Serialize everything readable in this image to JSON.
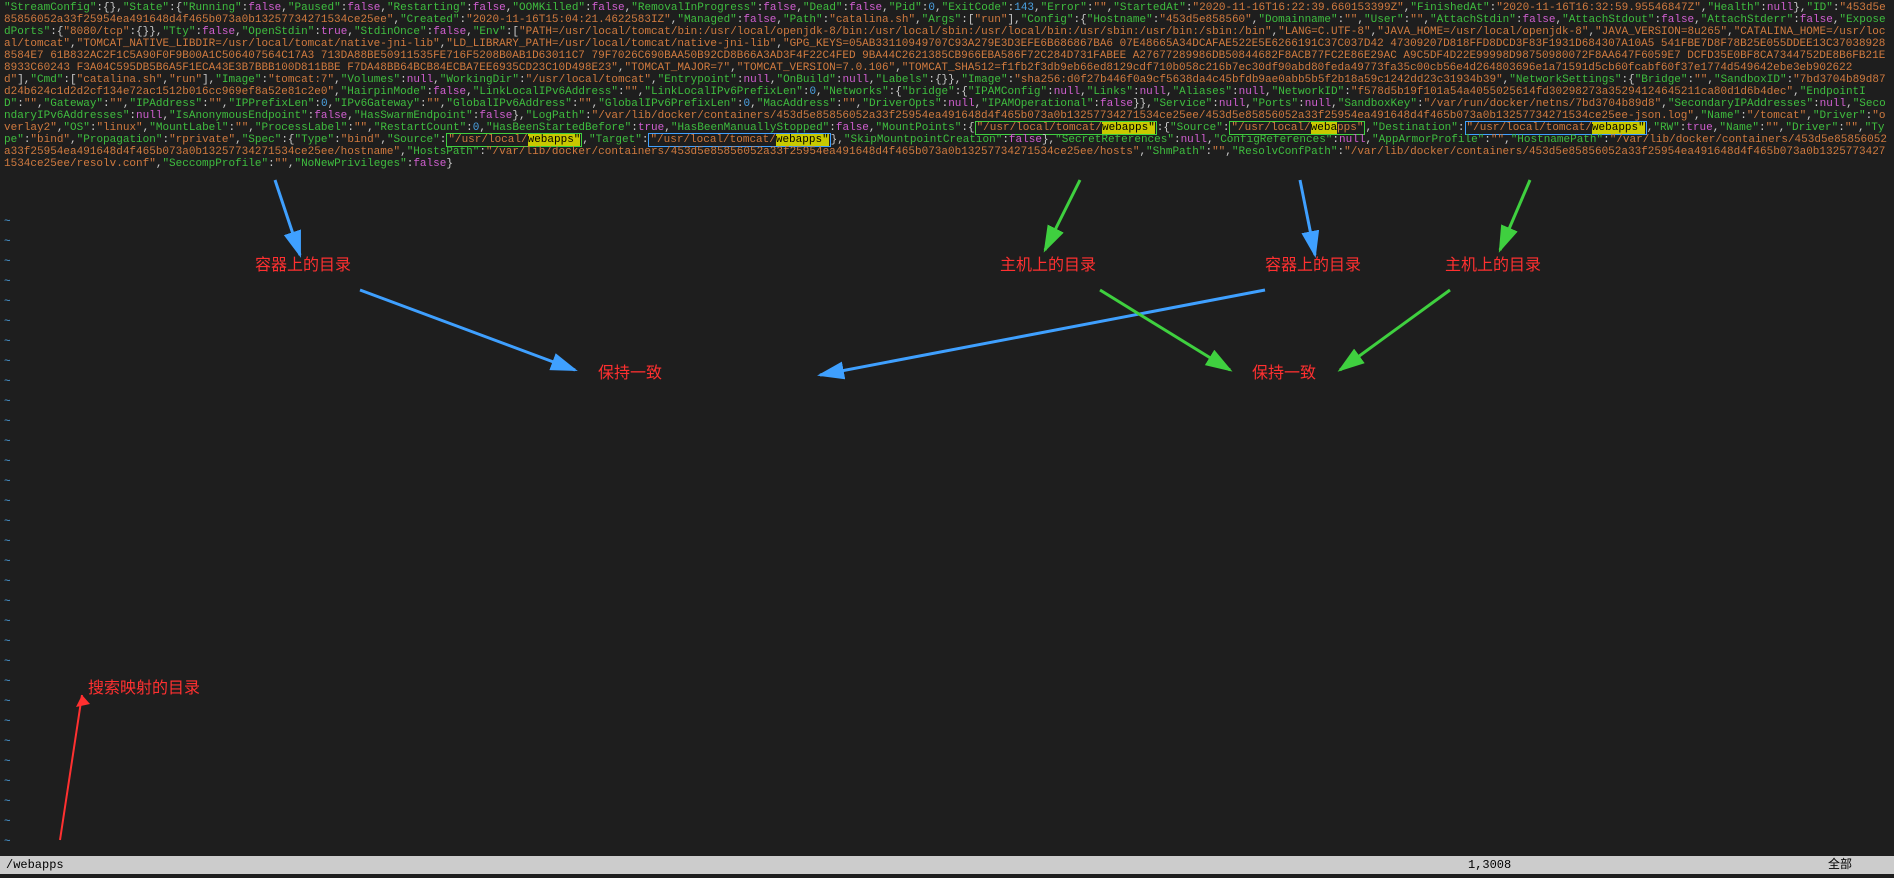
{
  "json_blocks": [
    [
      "k",
      "\"StreamConfig\"",
      "p",
      ":{},",
      "k",
      "\"State\"",
      "p",
      ":{",
      "k",
      "\"Running\"",
      "p",
      ":",
      "b",
      "false",
      "p",
      ",",
      "k",
      "\"Paused\"",
      "p",
      ":",
      "b",
      "false",
      "p",
      ",",
      "k",
      "\"Restarting\"",
      "p",
      ":",
      "b",
      "false",
      "p",
      ",",
      "k",
      "\"OOMKilled\"",
      "p",
      ":",
      "b",
      "false",
      "p",
      ",",
      "k",
      "\"RemovalInProgress\"",
      "p",
      ":",
      "b",
      "false",
      "p",
      ",",
      "k",
      "\"Dead\"",
      "p",
      ":",
      "b",
      "false",
      "p",
      ",",
      "k",
      "\"Pid\"",
      "p",
      ":",
      "n",
      "0",
      "p",
      ",",
      "k",
      "\"ExitCode\"",
      "p",
      ":",
      "n",
      "143",
      "p",
      ",",
      "k",
      "\"Error\"",
      "p",
      ":",
      "s",
      "\"\"",
      "p",
      ",",
      "k",
      "\"StartedAt\"",
      "p",
      ":",
      "s",
      "\"2020-11-16T16:22:39.660153399Z\"",
      "p",
      ",",
      "k",
      "\"FinishedAt\"",
      "p",
      ":",
      "s",
      "\"2020-11-16T16:32:59.95546847Z\"",
      "p",
      ",",
      "k",
      "\"Health\"",
      "p",
      ":",
      "b",
      "null",
      "p",
      "},",
      "k",
      "\"ID\"",
      "p",
      ":",
      "s",
      "\"453d5e85856052a33f25954ea491648d4f465b073a0b13257734271534ce25ee\"",
      "p",
      ",",
      "k",
      "\"Created\"",
      "p",
      ":",
      "s",
      "\"2020-11-16T15:04:21.4622583IZ\"",
      "p",
      ",",
      "k",
      "\"Managed\"",
      "p",
      ":",
      "b",
      "false",
      "p",
      ",",
      "k",
      "\"Path\"",
      "p",
      ":",
      "s",
      "\"catalina.sh\"",
      "p",
      ",",
      "k",
      "\"Args\"",
      "p",
      ":[",
      "s",
      "\"run\"",
      "p",
      "],",
      "k",
      "\"Config\"",
      "p",
      ":{",
      "k",
      "\"Hostname\"",
      "p",
      ":",
      "s",
      "\"453d5e858560\"",
      "p",
      ",",
      "k",
      "\"Domainname\"",
      "p",
      ":",
      "s",
      "\"\"",
      "p",
      ",",
      "k",
      "\"User\"",
      "p",
      ":",
      "s",
      "\"\"",
      "p",
      ",",
      "k",
      "\"AttachStdin\"",
      "p",
      ":",
      "b",
      "false",
      "p",
      ",",
      "k",
      "\"AttachStdout\"",
      "p",
      ":",
      "b",
      "false",
      "p",
      ",",
      "k",
      "\"AttachStderr\"",
      "p",
      ":",
      "b",
      "false",
      "p",
      ",",
      "k",
      "\"ExposedPorts\"",
      "p",
      ":{",
      "s",
      "\"8080/tcp\"",
      "p",
      ":{}},",
      "k",
      "\"Tty\"",
      "p",
      ":",
      "b",
      "false",
      "p",
      ",",
      "k",
      "\"OpenStdin\"",
      "p",
      ":",
      "b",
      "true",
      "p",
      ",",
      "k",
      "\"StdinOnce\"",
      "p",
      ":",
      "b",
      "false",
      "p",
      ",",
      "k",
      "\"Env\"",
      "p",
      ":[",
      "s",
      "\"PATH=/usr/local/tomcat/bin:/usr/local/openjdk-8/bin:/usr/local/sbin:/usr/local/bin:/usr/sbin:/usr/bin:/sbin:/bin\"",
      "p",
      ",",
      "s",
      "\"LANG=C.UTF-8\"",
      "p",
      ",",
      "s",
      "\"JAVA_HOME=/usr/local/openjdk-8\"",
      "p",
      ",",
      "s",
      "\"JAVA_VERSION=8u265\"",
      "p",
      ",",
      "s",
      "\"CATALINA_HOME=/usr/local/tomcat\"",
      "p",
      ",",
      "s",
      "\"TOMCAT_NATIVE_LIBDIR=/usr/local/tomcat/native-jni-lib\"",
      "p",
      ",",
      "s",
      "\"LD_LIBRARY_PATH=/usr/local/tomcat/native-jni-lib\"",
      "p",
      ",",
      "s",
      "\"GPG_KEYS=05AB33110949707C93A279E3D3EFE6B686867BA6 07E48665A34DCAFAE522E5E6266191C37C037D42 47309207D818FFD8DCD3F83F1931D684307A10A5 541FBE7D8F78B25E055DDEE13C370389288584E7 61B832AC2F1C5A90F0F9B00A1C506407564C17A3 713DA88BE50911535FE716F5208B0AB1D63011C7 79F7026C690BAA50B92CD8B66A3AD3F4F22C4FED 9BA44C2621385CB966EBA586F72C284D731FABEE A27677289986DB50844682F8ACB77FC2E86E29AC A9C5DF4D22E99998D98750980072F8AA647F6059E7 DCFD35E0BF8CA7344752DE8B6FB21E8933C60243 F3A04C595DB5B6A5F1ECA43E3B7BBB100D811BBE F7DA48BB64BCB84ECBA7EE6935CD23C10D498E23\"",
      "p",
      ",",
      "s",
      "\"TOMCAT_MAJOR=7\"",
      "p",
      ",",
      "s",
      "\"TOMCAT_VERSION=7.0.106\"",
      "p",
      ",",
      "s",
      "\"TOMCAT_SHA512=f1fb2f3db9eb66ed8129cdf710b058c216b7ec30df90abd80feda49773fa35c00cb56e4d264803696e1a71591d5cb60fcabf60f37e1774d549642ebe3eb902622d\"",
      "p",
      "],",
      "k",
      "\"Cmd\"",
      "p",
      ":[",
      "s",
      "\"catalina.sh\"",
      "p",
      ",",
      "s",
      "\"run\"",
      "p",
      "],",
      "k",
      "\"Image\"",
      "p",
      ":",
      "s",
      "\"tomcat:7\"",
      "p",
      ",",
      "k",
      "\"Volumes\"",
      "p",
      ":",
      "b",
      "null",
      "p",
      ",",
      "k",
      "\"WorkingDir\"",
      "p",
      ":",
      "s",
      "\"/usr/local/tomcat\"",
      "p",
      ",",
      "k",
      "\"Entrypoint\"",
      "p",
      ":",
      "b",
      "null",
      "p",
      ",",
      "k",
      "\"OnBuild\"",
      "p",
      ":",
      "b",
      "null",
      "p",
      ",",
      "k",
      "\"Labels\"",
      "p",
      ":{}},",
      "k",
      "\"Image\"",
      "p",
      ":",
      "s",
      "\"sha256:d0f27b446f0a9cf5638da4c45bfdb9ae0abb5b5f2b18a59c1242dd23c31934b39\"",
      "p",
      ",",
      "k",
      "\"NetworkSettings\"",
      "p",
      ":{",
      "k",
      "\"Bridge\"",
      "p",
      ":",
      "s",
      "\"\"",
      "p",
      ",",
      "k",
      "\"SandboxID\"",
      "p",
      ":",
      "s",
      "\"7bd3704b89d87d24b624c1d2d2cf134e72ac1512b016cc969ef8a52e81c2e0\"",
      "p",
      ",",
      "k",
      "\"HairpinMode\"",
      "p",
      ":",
      "b",
      "false",
      "p",
      ",",
      "k",
      "\"LinkLocalIPv6Address\"",
      "p",
      ":",
      "s",
      "\"\"",
      "p",
      ",",
      "k",
      "\"LinkLocalIPv6PrefixLen\"",
      "p",
      ":",
      "n",
      "0",
      "p",
      ",",
      "k",
      "\"Networks\"",
      "p",
      ":{",
      "k",
      "\"bridge\"",
      "p",
      ":{",
      "k",
      "\"IPAMConfig\"",
      "p",
      ":",
      "b",
      "null",
      "p",
      ",",
      "k",
      "\"Links\"",
      "p",
      ":",
      "b",
      "null",
      "p",
      ",",
      "k",
      "\"Aliases\"",
      "p",
      ":",
      "b",
      "null",
      "p",
      ",",
      "k",
      "\"NetworkID\"",
      "p",
      ":",
      "s",
      "\"f578d5b19f101a54a4055025614fd30298273a35294124645211ca80d1d6b4dec\"",
      "p",
      ",",
      "k",
      "\"EndpointID\"",
      "p",
      ":",
      "s",
      "\"\"",
      "p",
      ",",
      "k",
      "\"Gateway\"",
      "p",
      ":",
      "s",
      "\"\"",
      "p",
      ",",
      "k",
      "\"IPAddress\"",
      "p",
      ":",
      "s",
      "\"\"",
      "p",
      ",",
      "k",
      "\"IPPrefixLen\"",
      "p",
      ":",
      "n",
      "0",
      "p",
      ",",
      "k",
      "\"IPv6Gateway\"",
      "p",
      ":",
      "s",
      "\"\"",
      "p",
      ",",
      "k",
      "\"GlobalIPv6Address\"",
      "p",
      ":",
      "s",
      "\"\"",
      "p",
      ",",
      "k",
      "\"GlobalIPv6PrefixLen\"",
      "p",
      ":",
      "n",
      "0",
      "p",
      ",",
      "k",
      "\"MacAddress\"",
      "p",
      ":",
      "s",
      "\"\"",
      "p",
      ",",
      "k",
      "\"DriverOpts\"",
      "p",
      ":",
      "b",
      "null",
      "p",
      ",",
      "k",
      "\"IPAMOperational\"",
      "p",
      ":",
      "b",
      "false",
      "p",
      "}},",
      "k",
      "\"Service\"",
      "p",
      ":",
      "b",
      "null",
      "p",
      ",",
      "k",
      "\"Ports\"",
      "p",
      ":",
      "b",
      "null",
      "p",
      ",",
      "k",
      "\"SandboxKey\"",
      "p",
      ":",
      "s",
      "\"/var/run/docker/netns/7bd3704b89d8\"",
      "p",
      ",",
      "k",
      "\"SecondaryIPAddresses\"",
      "p",
      ":",
      "b",
      "null",
      "p",
      ",",
      "k",
      "\"SecondaryIPv6Addresses\"",
      "p",
      ":",
      "b",
      "null",
      "p",
      ",",
      "k",
      "\"IsAnonymousEndpoint\"",
      "p",
      ":",
      "b",
      "false",
      "p",
      ",",
      "k",
      "\"HasSwarmEndpoint\"",
      "p",
      ":",
      "b",
      "false",
      "p",
      "},",
      "k",
      "\"LogPath\"",
      "p",
      ":",
      "s",
      "\"/var/lib/docker/containers/453d5e85856052a33f25954ea491648d4f465b073a0b13257734271534ce25ee/453d5e85856052a33f25954ea491648d4f465b073a0b13257734271534ce25ee-json.log\"",
      "p",
      ",",
      "k",
      "\"Name\"",
      "p",
      ":",
      "s",
      "\"/tomcat\"",
      "p",
      ",",
      "k",
      "\"Driver\"",
      "p",
      ":",
      "s",
      "\"overlay2\"",
      "p",
      ",",
      "k",
      "\"OS\"",
      "p",
      ":",
      "s",
      "\"linux\"",
      "p",
      ",",
      "k",
      "\"MountLabel\"",
      "p",
      ":",
      "s",
      "\"\"",
      "p",
      ",",
      "k",
      "\"ProcessLabel\"",
      "p",
      ":",
      "s",
      "\"\"",
      "p",
      ",",
      "k",
      "\"RestartCount\"",
      "p",
      ":",
      "n",
      "0",
      "p",
      ",",
      "k",
      "\"HasBeenStartedBefore\"",
      "p",
      ":",
      "b",
      "true",
      "p",
      ",",
      "k",
      "\"HasBeenManuallyStopped\"",
      "p",
      ":",
      "b",
      "false",
      "p",
      ",",
      "k",
      "\"MountPoints\"",
      "p",
      ":{"
    ],
    [
      "p",
      "},",
      "k",
      "\"SecretReferences\"",
      "p",
      ":",
      "b",
      "null",
      "p",
      ",",
      "k",
      "\"ConfigReferences\"",
      "p",
      ":",
      "b",
      "null",
      "p",
      ",",
      "k",
      "\"AppArmorProfile\"",
      "p",
      ":",
      "s",
      "\"\"",
      "p",
      ",",
      "k",
      "\"HostnamePath\"",
      "p",
      ":",
      "s",
      "\"/var/lib/docker/containers/453d5e85856052a33f25954ea491648d4f465b073a0b13257734271534ce25ee/hostname\"",
      "p",
      ",",
      "k",
      "\"HostsPath\"",
      "p",
      ":",
      "s",
      "\"/var/lib/docker/containers/453d5e85856052a33f25954ea491648d4f465b073a0b13257734271534ce25ee/hosts\"",
      "p",
      ",",
      "k",
      "\"ShmPath\"",
      "p",
      ":",
      "s",
      "\"\"",
      "p",
      ",",
      "k",
      "\"ResolvConfPath\"",
      "p",
      ":",
      "s",
      "\"/var/lib/docker/containers/453d5e85856052a33f25954ea491648d4f465b073a0b13257734271534ce25ee/resolv.conf\"",
      "p",
      ",",
      "k",
      "\"SeccompProfile\"",
      "p",
      ":",
      "s",
      "\"\"",
      "p",
      ",",
      "k",
      "\"NoNewPrivileges\"",
      "p",
      ":",
      "b",
      "false",
      "p",
      "}"
    ]
  ],
  "mount_segment": {
    "box1_green_key": "\"/usr/local/tomcat/",
    "box1_green_hl": "webapps\"",
    "source_key": "\"Source\"",
    "box2_green_val": "\"/usr/local/",
    "box2_green_hl": "weba",
    "box2_green_tail": "pps\"",
    "dest_key": "\"Destination\"",
    "box1_blue_val": "\"/usr/local/tomcat/",
    "box1_blue_hl": "webapps\"",
    "rw_key": "\"RW\"",
    "rw_val": "true",
    "name_key": "\"Name\"",
    "driver_key": "\"Driver\"",
    "type_key": "\"Type\"",
    "type_val": "\"bind\"",
    "prop_key": "\"Propagation\"",
    "prop_val": "\"rprivate\"",
    "spec_key": "\"Spec\"",
    "spec_type_key": "\"Type\"",
    "spec_type_val": "\"bind\"",
    "spec_source_key": "\"Source\"",
    "box3_green_val": "\"/usr/local/",
    "box3_green_hl": "webapps\"",
    "target_key": "\"Target\"",
    "box2_blue_val": "\"/usr/local/tomcat/",
    "box2_blue_hl": "webapps\"",
    "skip_key": "\"SkipMountpointCreation\"",
    "skip_val": "false"
  },
  "labels": {
    "l1": "容器上的目录",
    "l2": "主机上的目录",
    "l3": "容器上的目录",
    "l4": "主机上的目录",
    "consist1": "保持一致",
    "consist2": "保持一致",
    "search": "搜索映射的目录"
  },
  "statusbar": {
    "left": "/webapps",
    "mid": "1,3008",
    "right": "全部"
  }
}
